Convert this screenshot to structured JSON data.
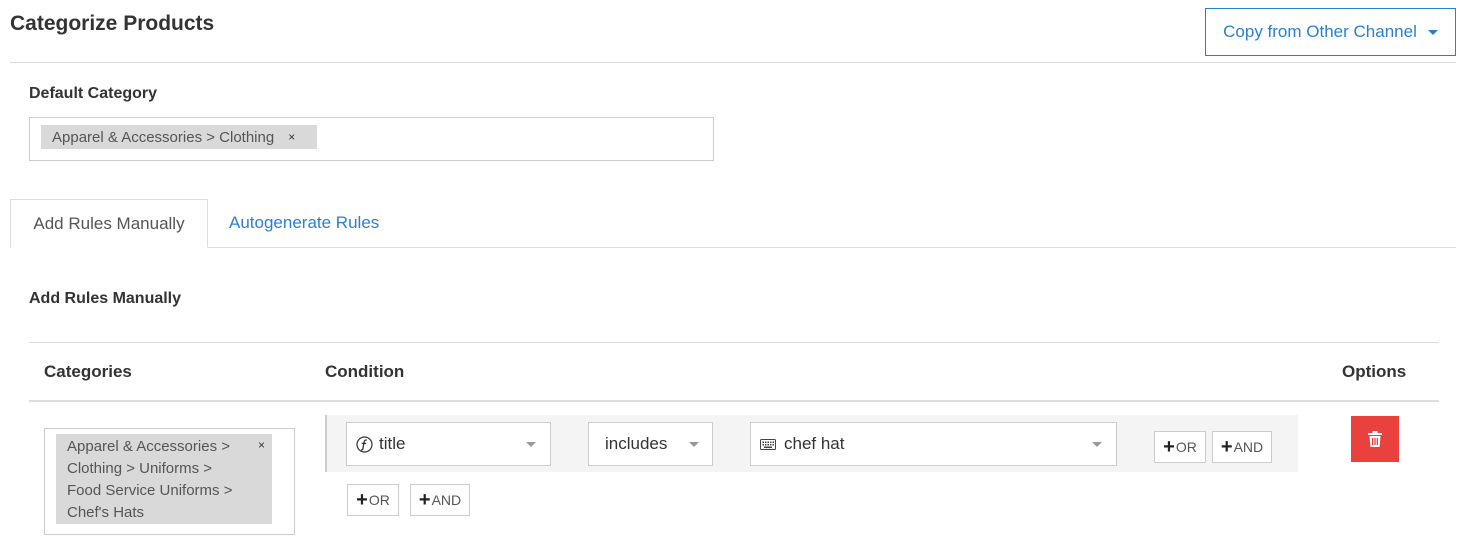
{
  "header": {
    "title": "Categorize Products",
    "copy_button": "Copy from Other Channel"
  },
  "default_category": {
    "label": "Default Category",
    "tags": [
      {
        "text": "Apparel & Accessories > Clothing",
        "remove": "×"
      }
    ]
  },
  "tabs": [
    {
      "label": "Add Rules Manually",
      "active": true
    },
    {
      "label": "Autogenerate Rules",
      "active": false
    }
  ],
  "section_title": "Add Rules Manually",
  "table": {
    "headers": {
      "categories": "Categories",
      "condition": "Condition",
      "options": "Options"
    },
    "rows": [
      {
        "category": {
          "lines": [
            "Apparel & Accessories >",
            "Clothing > Uniforms >",
            "Food Service Uniforms >",
            "Chef's Hats"
          ],
          "remove": "×"
        },
        "condition": {
          "field": "title",
          "field_icon": "function-icon",
          "operator": "includes",
          "value": "chef hat",
          "value_icon": "keyboard-icon",
          "inline_or": "OR",
          "inline_and": "AND"
        },
        "group_or": "OR",
        "group_and": "AND"
      }
    ]
  },
  "colors": {
    "accent": "#2a7fd4",
    "danger": "#e8413e",
    "tag_bg": "#d9d9d9",
    "border": "#cccccc"
  }
}
